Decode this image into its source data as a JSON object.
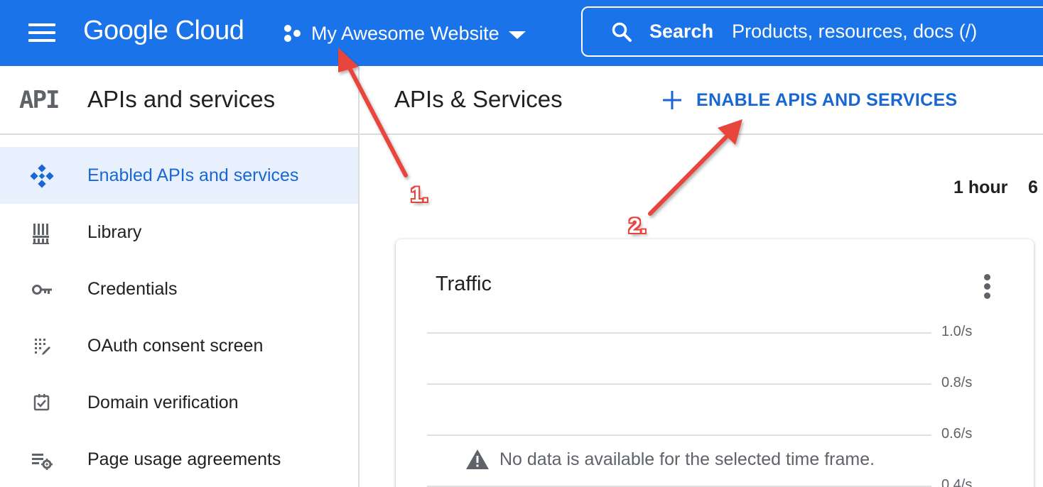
{
  "header": {
    "logo_text": "Google Cloud",
    "project_name": "My Awesome Website",
    "search_label": "Search",
    "search_placeholder": "Products, resources, docs (/)",
    "bar_color": "#1a73e8"
  },
  "sidebar": {
    "badge": "API",
    "title": "APIs and services",
    "items": [
      {
        "label": "Enabled APIs and services",
        "icon": "enabled-apis-icon",
        "active": true
      },
      {
        "label": "Library",
        "icon": "library-icon",
        "active": false
      },
      {
        "label": "Credentials",
        "icon": "key-icon",
        "active": false
      },
      {
        "label": "OAuth consent screen",
        "icon": "oauth-icon",
        "active": false
      },
      {
        "label": "Domain verification",
        "icon": "checkbox-icon",
        "active": false
      },
      {
        "label": "Page usage agreements",
        "icon": "settings-list-icon",
        "active": false
      }
    ]
  },
  "main": {
    "title": "APIs & Services",
    "enable_button": "ENABLE APIS AND SERVICES",
    "time_ranges": [
      "1 hour",
      "6"
    ],
    "accent_color": "#1967d2"
  },
  "traffic_card": {
    "title": "Traffic",
    "y_ticks": [
      "1.0/s",
      "0.8/s",
      "0.6/s",
      "0.4/s"
    ],
    "no_data_message": "No data is available for the selected time frame."
  },
  "annotations": {
    "step1": "1.",
    "step2": "2.",
    "arrow_color": "#e8453c"
  }
}
